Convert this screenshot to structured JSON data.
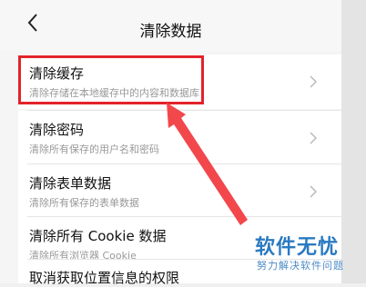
{
  "header": {
    "title": "清除数据",
    "back_icon": "chevron-left-icon"
  },
  "items": [
    {
      "label": "清除缓存",
      "subtitle": "清除存储在本地缓存中的内容和数据库",
      "highlighted": true
    },
    {
      "label": "清除密码",
      "subtitle": "清除所有保存的用户名和密码"
    },
    {
      "label": "清除表单数据",
      "subtitle": "清除所有保存的表单数据"
    },
    {
      "label": "清除所有 Cookie 数据",
      "subtitle": "清除所有浏览器 Cookie"
    },
    {
      "label": "取消获取位置信息的权限",
      "subtitle": ""
    }
  ],
  "annotation": {
    "highlight_color": "#e2232a",
    "arrow_color": "#f2484c"
  },
  "watermark": {
    "brand": "软件无忧",
    "tagline": "努力解决软件问题"
  }
}
